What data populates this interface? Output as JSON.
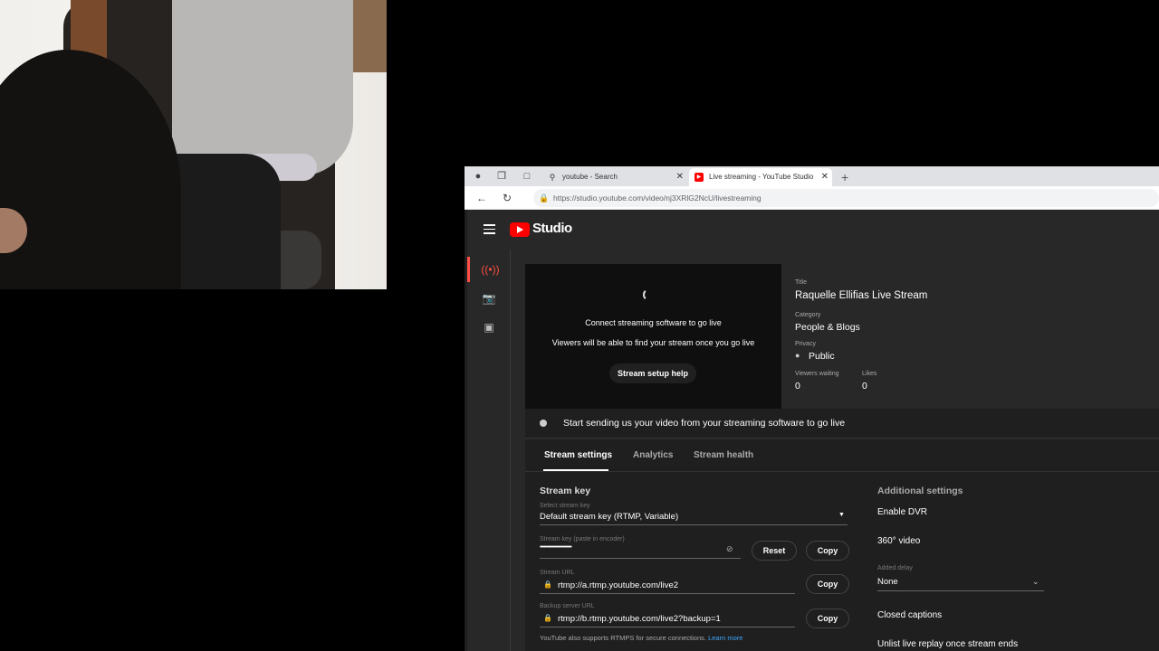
{
  "browser": {
    "tabs": [
      {
        "label": "youtube - Search",
        "icon": "search-icon"
      },
      {
        "label": "Live streaming - YouTube Studio",
        "icon": "youtube-icon"
      }
    ],
    "url": "https://studio.youtube.com/video/nj3XRlG2NcU/livestreaming"
  },
  "studio": {
    "logo_text": "Studio"
  },
  "preview": {
    "line1": "Connect streaming software to go live",
    "line2": "Viewers will be able to find your stream once you go live",
    "help_button": "Stream setup help"
  },
  "info": {
    "title_label": "Title",
    "title": "Raquelle Ellifias Live Stream",
    "category_label": "Category",
    "category": "People & Blogs",
    "privacy_label": "Privacy",
    "privacy": "Public",
    "viewers_label": "Viewers waiting",
    "viewers": "0",
    "likes_label": "Likes",
    "likes": "0"
  },
  "status": {
    "text": "Start sending us your video from your streaming software to go live"
  },
  "tabs": {
    "items": [
      "Stream settings",
      "Analytics",
      "Stream health"
    ],
    "active": 0
  },
  "stream": {
    "section_title": "Stream key",
    "select_label": "Select stream key",
    "select_value": "Default stream key (RTMP, Variable)",
    "key_label": "Stream key (paste in encoder)",
    "key_value": "••••••••••••••••••••••••",
    "reset_button": "Reset",
    "copy_button": "Copy",
    "url_label": "Stream URL",
    "url_value": "rtmp://a.rtmp.youtube.com/live2",
    "backup_label": "Backup server URL",
    "backup_value": "rtmp://b.rtmp.youtube.com/live2?backup=1",
    "note": "YouTube also supports RTMPS for secure connections.",
    "note_link": "Learn more"
  },
  "additional": {
    "title": "Additional settings",
    "dvr": "Enable DVR",
    "video360": "360° video",
    "delay_label": "Added delay",
    "delay_value": "None",
    "captions": "Closed captions",
    "unlist": "Unlist live replay once stream ends"
  }
}
